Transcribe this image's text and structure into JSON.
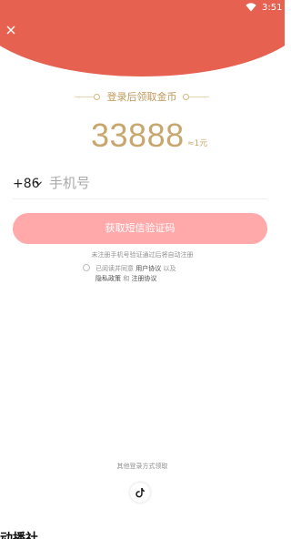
{
  "status_bar": {
    "time": "3:51",
    "wifi_icon": "wifi-icon"
  },
  "header": {
    "close_icon": "close-icon",
    "color": "#e66150"
  },
  "reward": {
    "title": "登录后领取金币",
    "amount": "33888",
    "equivalent": "≈1元",
    "color": "#c8a76f"
  },
  "phone_form": {
    "country_code": "+86",
    "chevron_icon": "chevron-down-icon",
    "phone_placeholder": "手机号",
    "phone_value": "",
    "get_code_label": "获取短信验证码",
    "button_color": "#ffa9ab"
  },
  "hints": {
    "auto_register": "未注册手机号验证通过后将自动注册",
    "agree_prefix": "已阅读并同意",
    "user_agreement": "用户协议",
    "and_1": "以及",
    "privacy_policy": "隐私政策",
    "and_2": "和",
    "register_agreement": "注册协议",
    "agree_checked": false
  },
  "other_login": {
    "label": "其他登录方式领取",
    "tiktok_icon": "tiktok-icon"
  },
  "bottom_text": "动播社"
}
